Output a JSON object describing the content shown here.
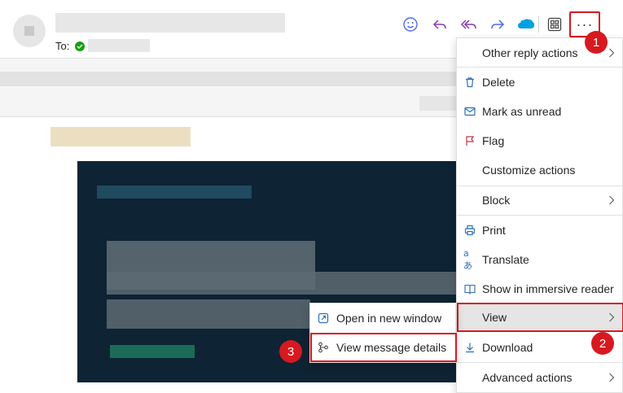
{
  "header": {
    "to_label": "To:"
  },
  "toolbar": {
    "icons": [
      "emoji-icon",
      "reply-icon",
      "reply-all-icon",
      "forward-icon",
      "salesforce-icon",
      "apps-icon"
    ],
    "more_label": "···",
    "accent_color": "#d71920"
  },
  "main_menu": {
    "items": [
      {
        "label": "Other reply actions",
        "icon": "",
        "submenu": true
      },
      {
        "label": "Delete",
        "icon": "trash-icon",
        "submenu": false
      },
      {
        "label": "Mark as unread",
        "icon": "envelope-icon",
        "submenu": false
      },
      {
        "label": "Flag",
        "icon": "flag-icon",
        "submenu": false
      },
      {
        "label": "Customize actions",
        "icon": "",
        "submenu": false
      },
      {
        "label": "Block",
        "icon": "",
        "submenu": true
      },
      {
        "label": "Print",
        "icon": "printer-icon",
        "submenu": false
      },
      {
        "label": "Translate",
        "icon": "translate-icon",
        "submenu": false
      },
      {
        "label": "Show in immersive reader",
        "icon": "immersive-reader-icon",
        "submenu": false
      },
      {
        "label": "View",
        "icon": "",
        "submenu": true,
        "active": true
      },
      {
        "label": "Download",
        "icon": "download-icon",
        "submenu": false
      },
      {
        "label": "Advanced actions",
        "icon": "",
        "submenu": true
      }
    ]
  },
  "sub_menu": {
    "items": [
      {
        "label": "Open in new window",
        "icon": "open-window-icon"
      },
      {
        "label": "View message details",
        "icon": "message-details-icon",
        "highlighted": true
      }
    ]
  },
  "badges": [
    "1",
    "2",
    "3"
  ]
}
